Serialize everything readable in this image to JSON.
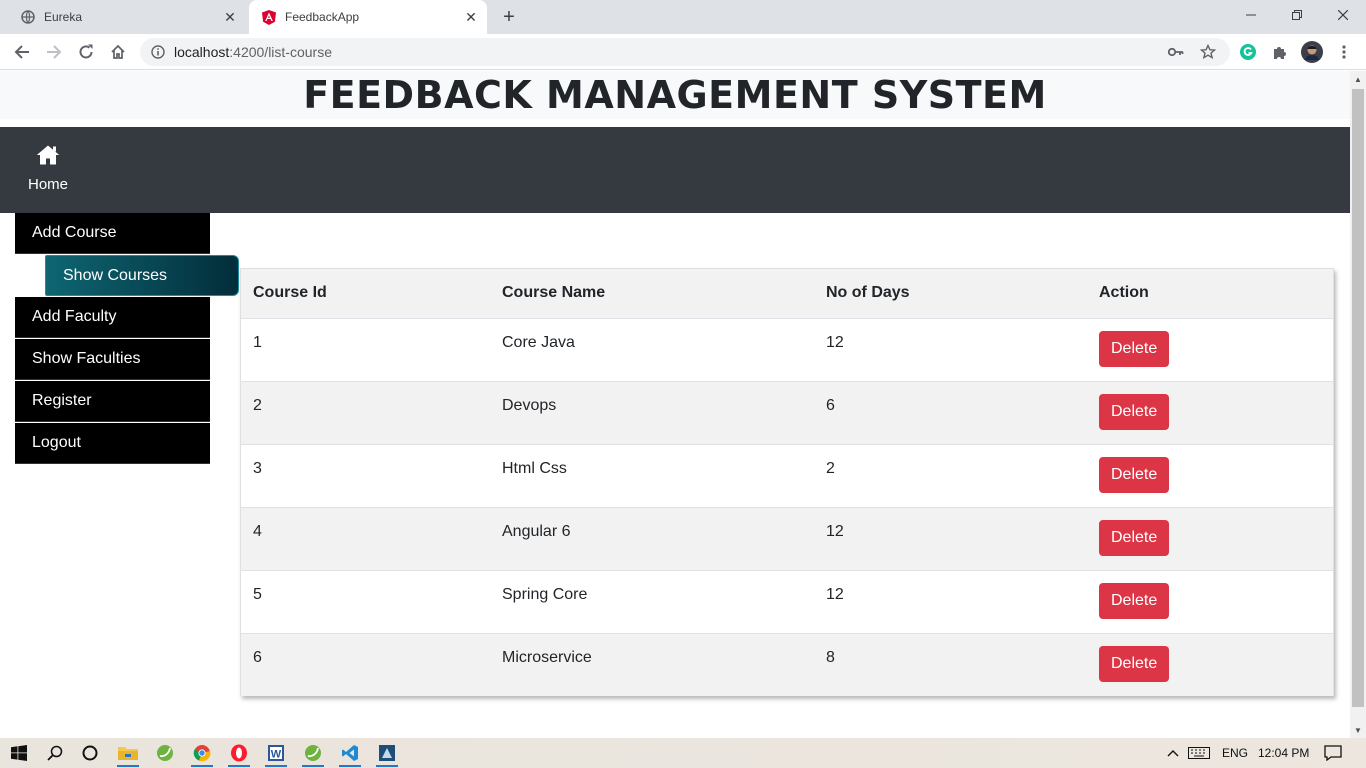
{
  "browser": {
    "tabs": [
      {
        "title": "Eureka",
        "active": false
      },
      {
        "title": "FeedbackApp",
        "active": true
      }
    ],
    "url_host": "localhost",
    "url_path": ":4200/list-course"
  },
  "app": {
    "title": "FEEDBACK MANAGEMENT SYSTEM",
    "nav": {
      "home_label": "Home"
    },
    "sidebar": {
      "items": [
        {
          "label": "Add Course",
          "active": false
        },
        {
          "label": "Show Courses",
          "active": true
        },
        {
          "label": "Add Faculty",
          "active": false
        },
        {
          "label": "Show Faculties",
          "active": false
        },
        {
          "label": "Register",
          "active": false
        },
        {
          "label": "Logout",
          "active": false
        }
      ]
    },
    "table": {
      "headers": [
        "Course Id",
        "Course Name",
        "No of Days",
        "Action"
      ],
      "rows": [
        {
          "id": "1",
          "name": "Core Java",
          "days": "12",
          "action": "Delete"
        },
        {
          "id": "2",
          "name": "Devops",
          "days": "6",
          "action": "Delete"
        },
        {
          "id": "3",
          "name": "Html Css",
          "days": "2",
          "action": "Delete"
        },
        {
          "id": "4",
          "name": "Angular 6",
          "days": "12",
          "action": "Delete"
        },
        {
          "id": "5",
          "name": "Spring Core",
          "days": "12",
          "action": "Delete"
        },
        {
          "id": "6",
          "name": "Microservice",
          "days": "8",
          "action": "Delete"
        }
      ]
    }
  },
  "taskbar": {
    "language": "ENG",
    "time": "12:04 PM"
  },
  "colors": {
    "navbar": "#343a40",
    "sidebar": "#000000",
    "sidebar_active": "#0e6672",
    "delete_button": "#dc3545"
  }
}
